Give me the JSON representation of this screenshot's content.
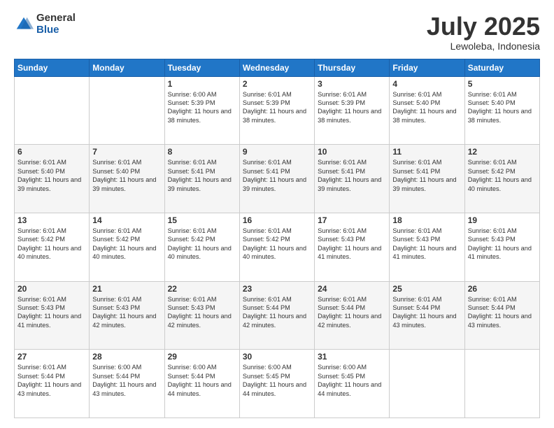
{
  "header": {
    "logo_general": "General",
    "logo_blue": "Blue",
    "month": "July 2025",
    "location": "Lewoleba, Indonesia"
  },
  "weekdays": [
    "Sunday",
    "Monday",
    "Tuesday",
    "Wednesday",
    "Thursday",
    "Friday",
    "Saturday"
  ],
  "weeks": [
    [
      {
        "day": "",
        "content": ""
      },
      {
        "day": "",
        "content": ""
      },
      {
        "day": "1",
        "content": "Sunrise: 6:00 AM\nSunset: 5:39 PM\nDaylight: 11 hours and 38 minutes."
      },
      {
        "day": "2",
        "content": "Sunrise: 6:01 AM\nSunset: 5:39 PM\nDaylight: 11 hours and 38 minutes."
      },
      {
        "day": "3",
        "content": "Sunrise: 6:01 AM\nSunset: 5:39 PM\nDaylight: 11 hours and 38 minutes."
      },
      {
        "day": "4",
        "content": "Sunrise: 6:01 AM\nSunset: 5:40 PM\nDaylight: 11 hours and 38 minutes."
      },
      {
        "day": "5",
        "content": "Sunrise: 6:01 AM\nSunset: 5:40 PM\nDaylight: 11 hours and 38 minutes."
      }
    ],
    [
      {
        "day": "6",
        "content": "Sunrise: 6:01 AM\nSunset: 5:40 PM\nDaylight: 11 hours and 39 minutes."
      },
      {
        "day": "7",
        "content": "Sunrise: 6:01 AM\nSunset: 5:40 PM\nDaylight: 11 hours and 39 minutes."
      },
      {
        "day": "8",
        "content": "Sunrise: 6:01 AM\nSunset: 5:41 PM\nDaylight: 11 hours and 39 minutes."
      },
      {
        "day": "9",
        "content": "Sunrise: 6:01 AM\nSunset: 5:41 PM\nDaylight: 11 hours and 39 minutes."
      },
      {
        "day": "10",
        "content": "Sunrise: 6:01 AM\nSunset: 5:41 PM\nDaylight: 11 hours and 39 minutes."
      },
      {
        "day": "11",
        "content": "Sunrise: 6:01 AM\nSunset: 5:41 PM\nDaylight: 11 hours and 39 minutes."
      },
      {
        "day": "12",
        "content": "Sunrise: 6:01 AM\nSunset: 5:42 PM\nDaylight: 11 hours and 40 minutes."
      }
    ],
    [
      {
        "day": "13",
        "content": "Sunrise: 6:01 AM\nSunset: 5:42 PM\nDaylight: 11 hours and 40 minutes."
      },
      {
        "day": "14",
        "content": "Sunrise: 6:01 AM\nSunset: 5:42 PM\nDaylight: 11 hours and 40 minutes."
      },
      {
        "day": "15",
        "content": "Sunrise: 6:01 AM\nSunset: 5:42 PM\nDaylight: 11 hours and 40 minutes."
      },
      {
        "day": "16",
        "content": "Sunrise: 6:01 AM\nSunset: 5:42 PM\nDaylight: 11 hours and 40 minutes."
      },
      {
        "day": "17",
        "content": "Sunrise: 6:01 AM\nSunset: 5:43 PM\nDaylight: 11 hours and 41 minutes."
      },
      {
        "day": "18",
        "content": "Sunrise: 6:01 AM\nSunset: 5:43 PM\nDaylight: 11 hours and 41 minutes."
      },
      {
        "day": "19",
        "content": "Sunrise: 6:01 AM\nSunset: 5:43 PM\nDaylight: 11 hours and 41 minutes."
      }
    ],
    [
      {
        "day": "20",
        "content": "Sunrise: 6:01 AM\nSunset: 5:43 PM\nDaylight: 11 hours and 41 minutes."
      },
      {
        "day": "21",
        "content": "Sunrise: 6:01 AM\nSunset: 5:43 PM\nDaylight: 11 hours and 42 minutes."
      },
      {
        "day": "22",
        "content": "Sunrise: 6:01 AM\nSunset: 5:43 PM\nDaylight: 11 hours and 42 minutes."
      },
      {
        "day": "23",
        "content": "Sunrise: 6:01 AM\nSunset: 5:44 PM\nDaylight: 11 hours and 42 minutes."
      },
      {
        "day": "24",
        "content": "Sunrise: 6:01 AM\nSunset: 5:44 PM\nDaylight: 11 hours and 42 minutes."
      },
      {
        "day": "25",
        "content": "Sunrise: 6:01 AM\nSunset: 5:44 PM\nDaylight: 11 hours and 43 minutes."
      },
      {
        "day": "26",
        "content": "Sunrise: 6:01 AM\nSunset: 5:44 PM\nDaylight: 11 hours and 43 minutes."
      }
    ],
    [
      {
        "day": "27",
        "content": "Sunrise: 6:01 AM\nSunset: 5:44 PM\nDaylight: 11 hours and 43 minutes."
      },
      {
        "day": "28",
        "content": "Sunrise: 6:00 AM\nSunset: 5:44 PM\nDaylight: 11 hours and 43 minutes."
      },
      {
        "day": "29",
        "content": "Sunrise: 6:00 AM\nSunset: 5:44 PM\nDaylight: 11 hours and 44 minutes."
      },
      {
        "day": "30",
        "content": "Sunrise: 6:00 AM\nSunset: 5:45 PM\nDaylight: 11 hours and 44 minutes."
      },
      {
        "day": "31",
        "content": "Sunrise: 6:00 AM\nSunset: 5:45 PM\nDaylight: 11 hours and 44 minutes."
      },
      {
        "day": "",
        "content": ""
      },
      {
        "day": "",
        "content": ""
      }
    ]
  ]
}
